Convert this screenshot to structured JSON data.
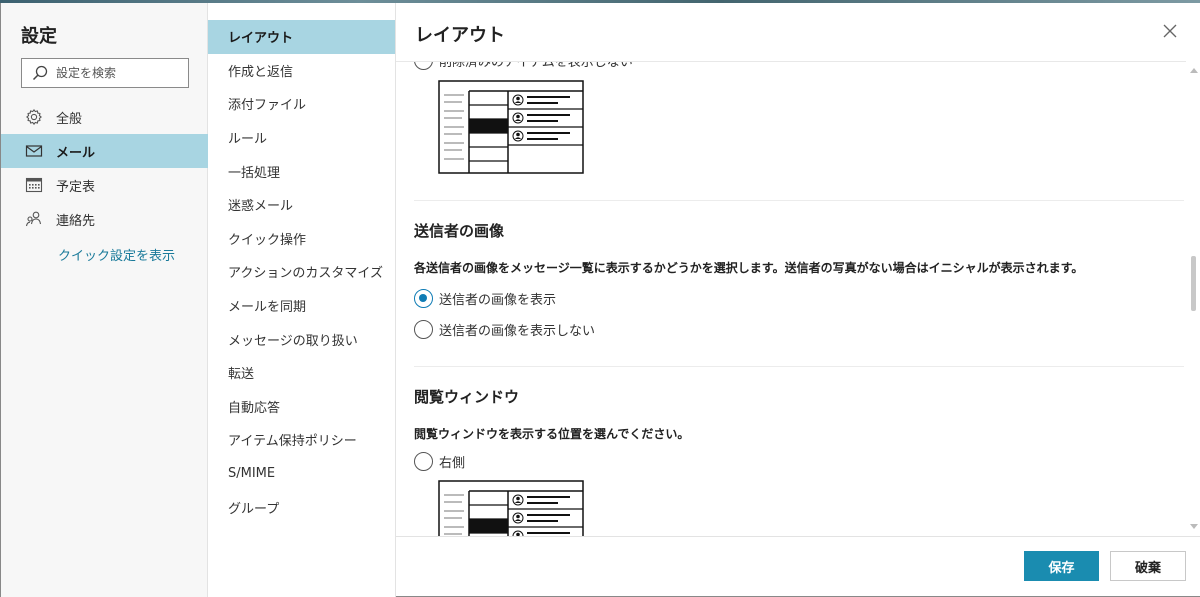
{
  "sidebar": {
    "title": "設定",
    "search_placeholder": "設定を検索",
    "items": [
      {
        "label": "全般",
        "icon": "gear-icon"
      },
      {
        "label": "メール",
        "icon": "mail-icon"
      },
      {
        "label": "予定表",
        "icon": "calendar-icon"
      },
      {
        "label": "連絡先",
        "icon": "people-icon"
      }
    ],
    "quick_settings_link": "クイック設定を表示"
  },
  "subnav": {
    "items": [
      {
        "label": "レイアウト"
      },
      {
        "label": "作成と返信"
      },
      {
        "label": "添付ファイル"
      },
      {
        "label": "ルール"
      },
      {
        "label": "一括処理"
      },
      {
        "label": "迷惑メール"
      },
      {
        "label": "クイック操作"
      },
      {
        "label": "アクションのカスタマイズ"
      },
      {
        "label": "メールを同期"
      },
      {
        "label": "メッセージの取り扱い"
      },
      {
        "label": "転送"
      },
      {
        "label": "自動応答"
      },
      {
        "label": "アイテム保持ポリシー"
      },
      {
        "label": "S/MIME"
      },
      {
        "label": "グループ"
      }
    ]
  },
  "content": {
    "title": "レイアウト",
    "partial_option": "削除済みのアイテムを表示しない",
    "sender_image": {
      "heading": "送信者の画像",
      "description": "各送信者の画像をメッセージ一覧に表示するかどうかを選択します。送信者の写真がない場合はイニシャルが表示されます。",
      "options": [
        {
          "label": "送信者の画像を表示",
          "checked": true
        },
        {
          "label": "送信者の画像を表示しない",
          "checked": false
        }
      ]
    },
    "reading_pane": {
      "heading": "閲覧ウィンドウ",
      "description": "閲覧ウィンドウを表示する位置を選んでください。",
      "options": [
        {
          "label": "右側",
          "checked": false
        }
      ]
    }
  },
  "footer": {
    "save_label": "保存",
    "discard_label": "破棄"
  },
  "colors": {
    "accent": "#1a8cb0",
    "selected_nav": "#a8d5e2",
    "link": "#1a7a9a"
  }
}
